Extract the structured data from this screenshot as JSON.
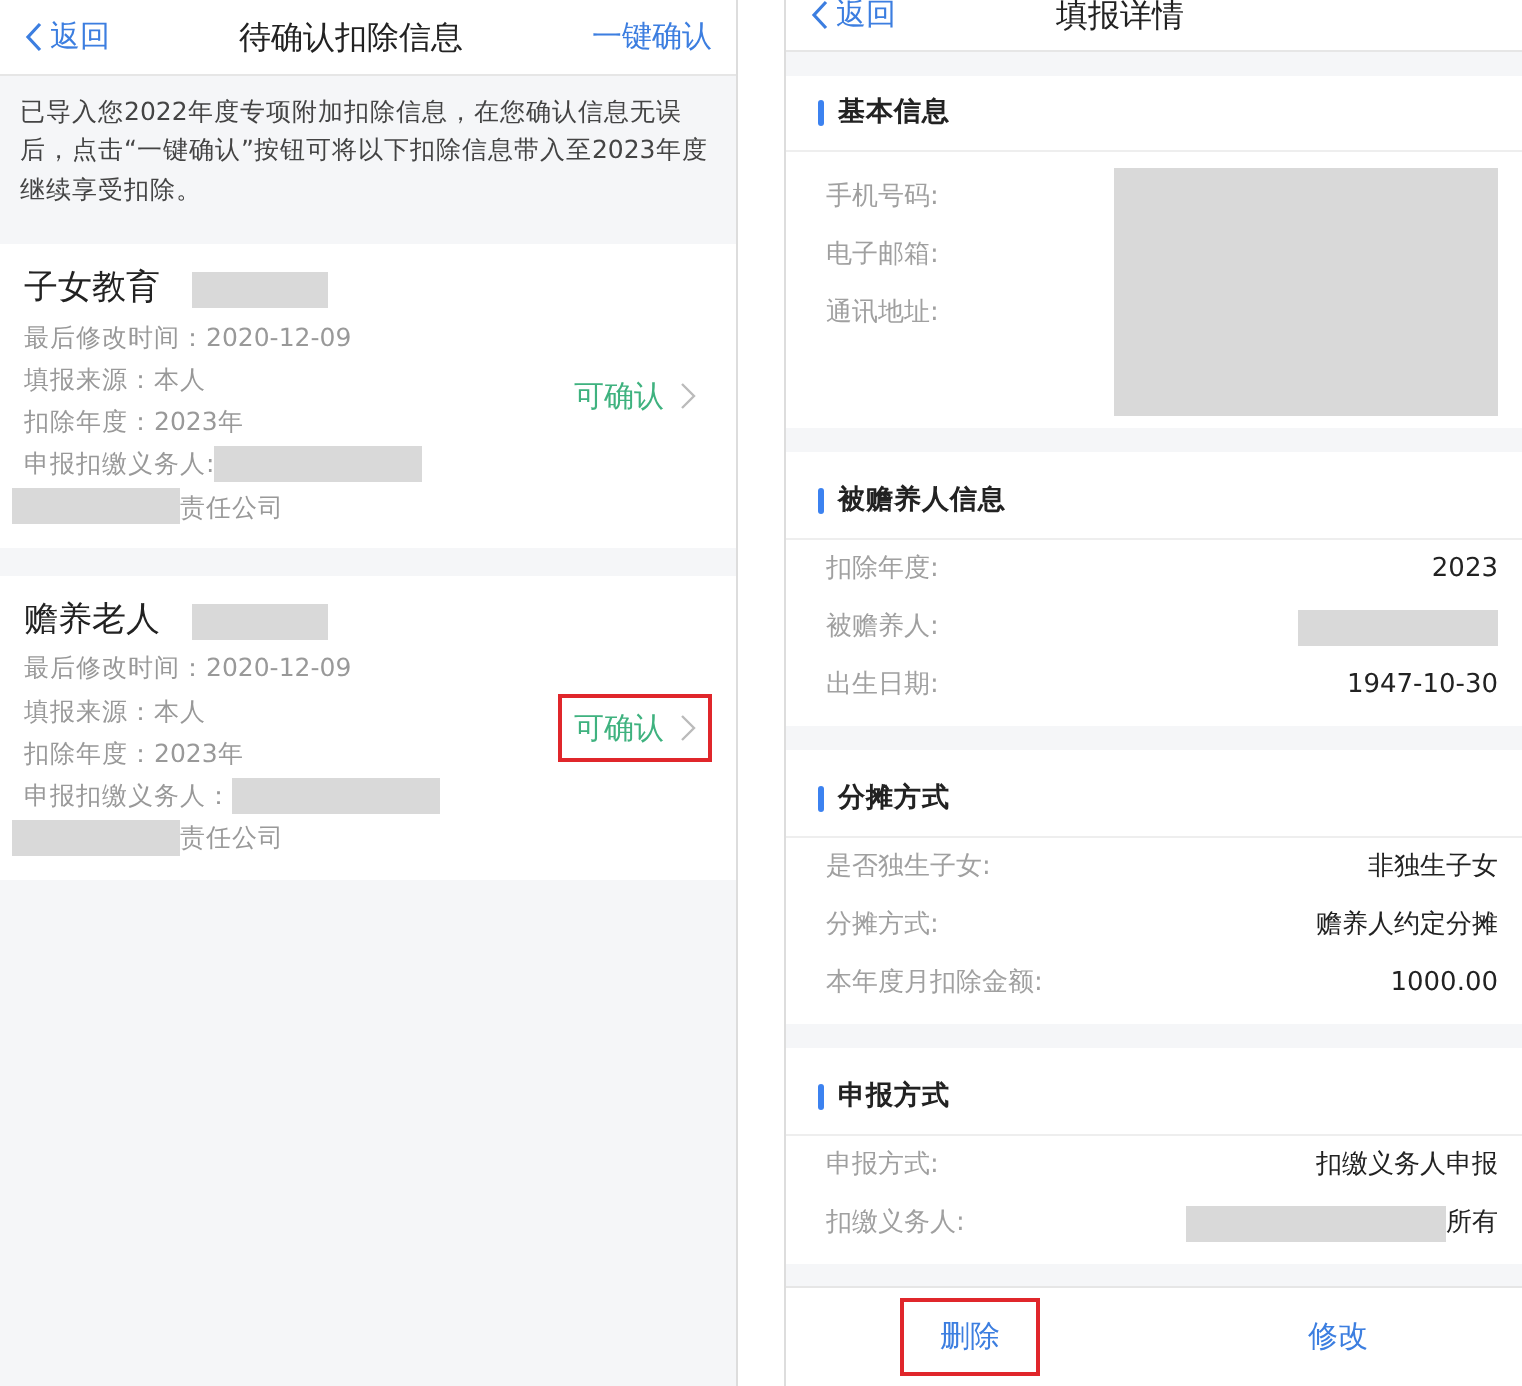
{
  "left_screen": {
    "back": "返回",
    "title": "待确认扣除信息",
    "action": "一键确认",
    "notice": "已导入您2022年度专项附加扣除信息，在您确认信息无误后，点击“一键确认”按钮可将以下扣除信息带入至2023年度继续享受扣除。",
    "cards": [
      {
        "title": "子女教育",
        "lines": [
          "最后修改时间：2020-12-09",
          "填报来源：本人",
          "扣除年度：2023年"
        ],
        "payer_label": "申报扣缴义务人:",
        "company_tail": "责任公司",
        "status": "可确认",
        "highlighted": false
      },
      {
        "title": "赡养老人",
        "lines": [
          "最后修改时间：2020-12-09",
          "填报来源：本人",
          "扣除年度：2023年"
        ],
        "payer_label": "申报扣缴义务人：",
        "company_tail": "责任公司",
        "status": "可确认",
        "highlighted": true
      }
    ]
  },
  "right_screen": {
    "back": "返回",
    "title": "填报详情",
    "sections": [
      {
        "title": "基本信息",
        "kind": "block",
        "rows": [
          {
            "label": "手机号码:"
          },
          {
            "label": "电子邮箱:"
          },
          {
            "label": "通讯地址:"
          }
        ]
      },
      {
        "title": "被赡养人信息",
        "kind": "rows",
        "rows": [
          {
            "label": "扣除年度:",
            "value": "2023",
            "redacted": false
          },
          {
            "label": "被赡养人:",
            "redacted": true
          },
          {
            "label": "出生日期:",
            "value": "1947-10-30",
            "redacted": false
          }
        ]
      },
      {
        "title": "分摊方式",
        "kind": "rows",
        "rows": [
          {
            "label": "是否独生子女:",
            "value": "非独生子女",
            "redacted": false
          },
          {
            "label": "分摊方式:",
            "value": "赡养人约定分摊",
            "redacted": false
          },
          {
            "label": "本年度月扣除金额:",
            "value": "1000.00",
            "redacted": false
          }
        ]
      },
      {
        "title": "申报方式",
        "kind": "rows",
        "rows": [
          {
            "label": "申报方式:",
            "value": "扣缴义务人申报",
            "redacted": false
          },
          {
            "label": "扣缴义务人:",
            "value": "所有",
            "redacted": true
          }
        ]
      }
    ],
    "buttons": [
      {
        "label": "删除",
        "highlighted": true
      },
      {
        "label": "修改",
        "highlighted": false
      }
    ]
  }
}
